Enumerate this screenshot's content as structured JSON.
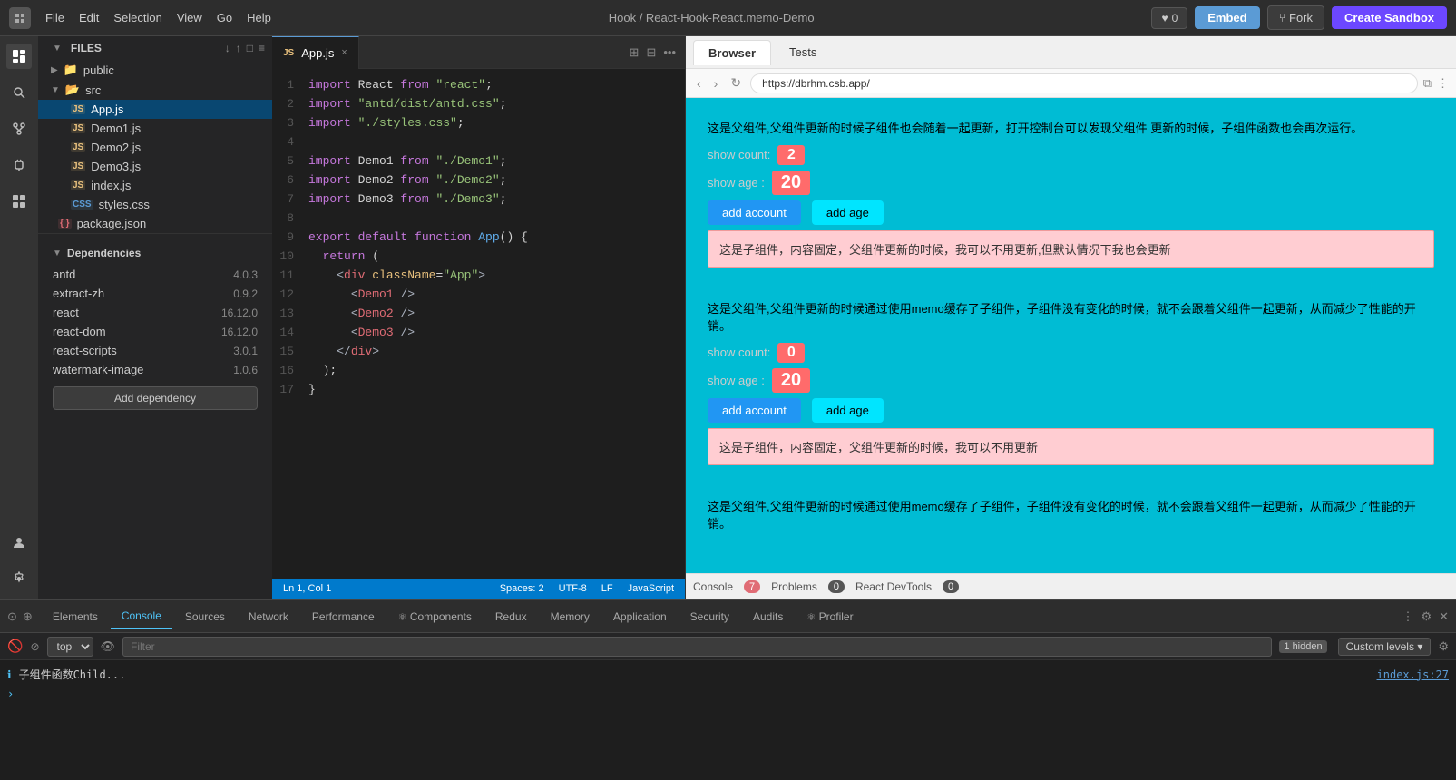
{
  "topbar": {
    "menu_items": [
      "File",
      "Edit",
      "Selection",
      "View",
      "Go",
      "Help"
    ],
    "breadcrumb": "Hook / React-Hook-React.memo-Demo",
    "heart_count": "0",
    "embed_label": "Embed",
    "fork_label": "Fork",
    "sandbox_label": "Create Sandbox"
  },
  "files_panel": {
    "title": "Files",
    "folders": [
      {
        "name": "public",
        "type": "folder-blue"
      },
      {
        "name": "src",
        "type": "folder-gray"
      }
    ],
    "src_files": [
      {
        "name": "App.js",
        "type": "js",
        "active": true
      },
      {
        "name": "Demo1.js",
        "type": "js",
        "active": false
      },
      {
        "name": "Demo2.js",
        "type": "js",
        "active": false
      },
      {
        "name": "Demo3.js",
        "type": "js",
        "active": false
      },
      {
        "name": "index.js",
        "type": "js",
        "active": false
      },
      {
        "name": "styles.css",
        "type": "css",
        "active": false
      }
    ],
    "root_files": [
      {
        "name": "package.json",
        "type": "json",
        "active": false
      }
    ]
  },
  "dependencies": {
    "title": "Dependencies",
    "items": [
      {
        "name": "antd",
        "version": "4.0.3"
      },
      {
        "name": "extract-zh",
        "version": "0.9.2"
      },
      {
        "name": "react",
        "version": "16.12.0"
      },
      {
        "name": "react-dom",
        "version": "16.12.0"
      },
      {
        "name": "react-scripts",
        "version": "3.0.1"
      },
      {
        "name": "watermark-image",
        "version": "1.0.6"
      }
    ],
    "add_label": "Add dependency"
  },
  "editor": {
    "active_tab": "App.js",
    "lines": [
      {
        "num": 1,
        "content": "import React from \"react\";"
      },
      {
        "num": 2,
        "content": "import \"antd/dist/antd.css\";"
      },
      {
        "num": 3,
        "content": "import \"./styles.css\";"
      },
      {
        "num": 4,
        "content": ""
      },
      {
        "num": 5,
        "content": "import Demo1 from \"./Demo1\";"
      },
      {
        "num": 6,
        "content": "import Demo2 from \"./Demo2\";"
      },
      {
        "num": 7,
        "content": "import Demo3 from \"./Demo3\";"
      },
      {
        "num": 8,
        "content": ""
      },
      {
        "num": 9,
        "content": "export default function App() {"
      },
      {
        "num": 10,
        "content": "  return ("
      },
      {
        "num": 11,
        "content": "    <div className=\"App\">"
      },
      {
        "num": 12,
        "content": "      <Demo1 />"
      },
      {
        "num": 13,
        "content": "      <Demo2 />"
      },
      {
        "num": 14,
        "content": "      <Demo3 />"
      },
      {
        "num": 15,
        "content": "    </div>"
      },
      {
        "num": 16,
        "content": "  );"
      },
      {
        "num": 17,
        "content": "}"
      }
    ],
    "status": {
      "line_col": "Ln 1, Col 1",
      "spaces": "Spaces: 2",
      "encoding": "UTF-8",
      "line_ending": "LF",
      "language": "JavaScript"
    }
  },
  "browser": {
    "tabs": [
      "Browser",
      "Tests"
    ],
    "active_tab": "Browser",
    "url": "https://dbrhm.csb.app/",
    "demo1": {
      "description": "这是父组件,父组件更新的时候子组件也会随着一起更新，打开控制台可以发现父组件 更新的时候，子组件函数也会再次运行。",
      "show_count_label": "show count:",
      "show_count_value": "2",
      "show_age_label": "show age :",
      "show_age_value": "20",
      "btn_add_account": "add account",
      "btn_add_age": "add age",
      "child_text": "这是子组件，内容固定，父组件更新的时候，我可以不用更新,但默认情况下我也会更新"
    },
    "demo2": {
      "description": "这是父组件,父组件更新的时候通过使用memo缓存了子组件，子组件没有变化的时候，就不会跟着父组件一起更新，从而减少了性能的开销。",
      "show_count_label": "show count:",
      "show_count_value": "0",
      "show_age_label": "show age :",
      "show_age_value": "20",
      "btn_add_account": "add account",
      "btn_add_age": "add age",
      "child_text": "这是子组件，内容固定，父组件更新的时候，我可以不用更新"
    },
    "demo3": {
      "description": "这是父组件,父组件更新的时候通过使用memo缓存了子组件，子组件没有变化的时候，就不会跟着父组件一起更新，从而减少了性能的开销。"
    }
  },
  "devtools": {
    "tabs": [
      "Elements",
      "Console",
      "Sources",
      "Network",
      "Performance",
      "Components",
      "Redux",
      "Memory",
      "Application",
      "Security",
      "Audits",
      "Profiler"
    ],
    "active_tab": "Console",
    "console_badge": "7",
    "problems_badge": "0",
    "react_devtools_badge": "0",
    "toolbar": {
      "top_label": "top",
      "filter_placeholder": "Filter",
      "custom_levels": "Custom levels"
    },
    "log_line": "子组件函数Child...",
    "log_link": "index.js:27",
    "hidden_count": "1 hidden"
  }
}
